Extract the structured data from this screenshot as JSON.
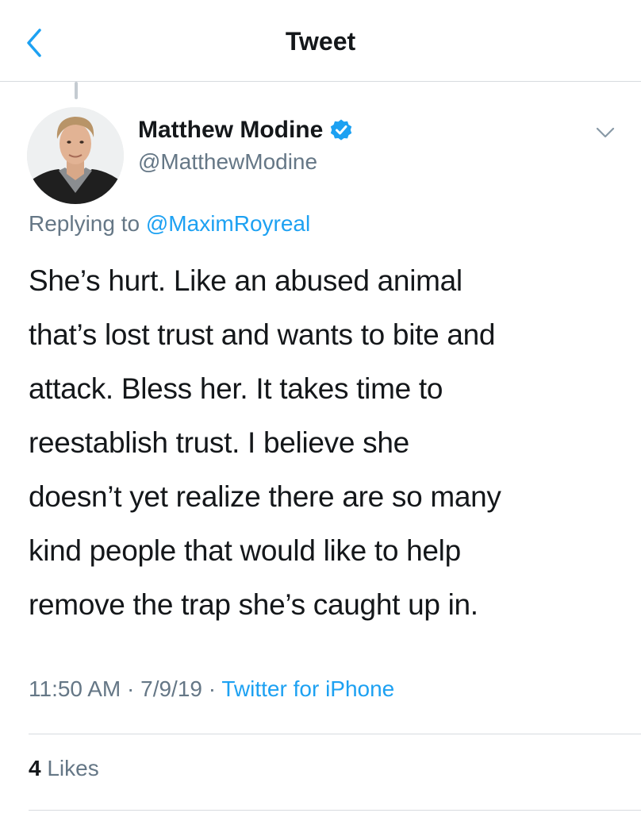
{
  "header": {
    "title": "Tweet",
    "back_icon": "chevron-left-icon"
  },
  "tweet": {
    "author": {
      "display_name": "Matthew Modine",
      "handle": "@MatthewModine",
      "verified": true
    },
    "replying_to": {
      "prefix": "Replying to",
      "handle": "@MaximRoyreal"
    },
    "text_lines": [
      "She’s hurt. Like an abused animal",
      "that’s lost trust and wants to bite and",
      "attack. Bless her. It takes time to",
      "reestablish trust. I believe she",
      "doesn’t yet realize there are so many",
      "kind people that would like to help",
      "remove the trap she’s caught up in."
    ],
    "time": "11:50 AM",
    "separator": "·",
    "date": "7/9/19",
    "source": "Twitter for iPhone",
    "stats": {
      "likes_count": "4",
      "likes_label": "Likes"
    }
  },
  "colors": {
    "accent": "#1da1f2",
    "secondary_text": "#657786",
    "primary_text": "#14171a",
    "divider": "#d7dbdf"
  }
}
